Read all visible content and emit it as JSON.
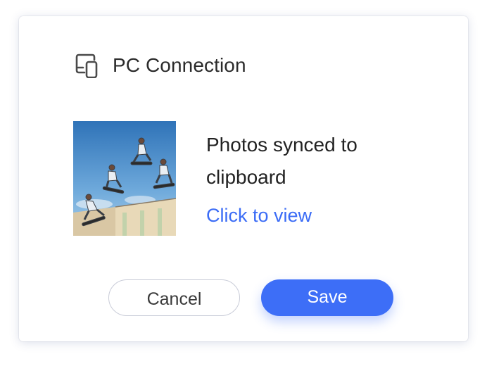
{
  "dialog": {
    "header": {
      "icon": "devices-icon",
      "title": "PC Connection"
    },
    "thumbnail": {
      "description_icon": "photo-thumbnail"
    },
    "message": "Photos synced to clipboard",
    "link_label": "Click to view",
    "buttons": {
      "cancel_label": "Cancel",
      "save_label": "Save"
    }
  },
  "colors": {
    "accent": "#3d6ef7",
    "link": "#3b6cf6",
    "text": "#222222",
    "cancel_border": "#c9ccd8"
  }
}
